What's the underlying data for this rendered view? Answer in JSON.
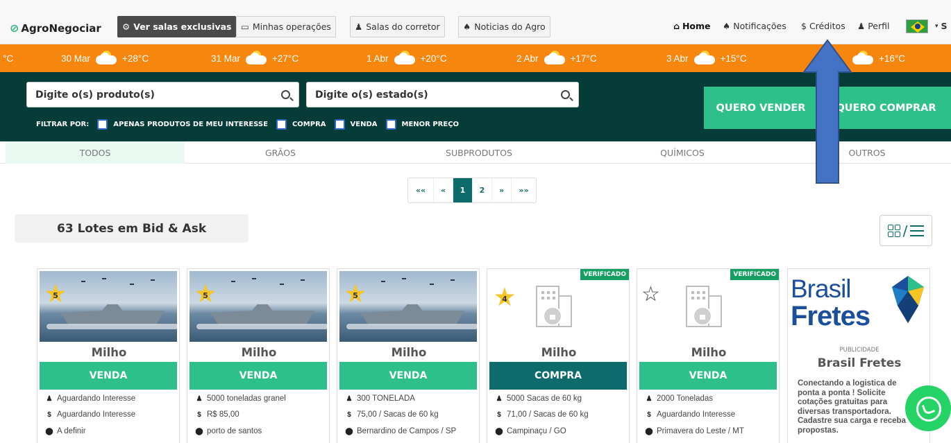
{
  "nav": {
    "logo": "AgroNegociar",
    "buttons": [
      {
        "label": "Ver salas exclusivas",
        "icon": "gear-icon"
      },
      {
        "label": "Minhas operações",
        "icon": "inbox-icon"
      },
      {
        "label": "Salas do corretor",
        "icon": "users-icon"
      },
      {
        "label": "Noticias do Agro",
        "icon": "bell-icon"
      }
    ],
    "right": [
      {
        "label": "Home",
        "icon": "home-icon"
      },
      {
        "label": "Notificações",
        "icon": "bell-icon"
      },
      {
        "label": "Créditos",
        "icon": "dollar-icon"
      },
      {
        "label": "Perfil",
        "icon": "user-icon"
      }
    ],
    "trailing": "S"
  },
  "weather": [
    {
      "date": "",
      "temp": "°C"
    },
    {
      "date": "30 Mar",
      "temp": "+28°C"
    },
    {
      "date": "31 Mar",
      "temp": "+27°C"
    },
    {
      "date": "1 Abr",
      "temp": "+20°C"
    },
    {
      "date": "2 Abr",
      "temp": "+17°C"
    },
    {
      "date": "3 Abr",
      "temp": "+15°C"
    },
    {
      "date": "",
      "temp": "+16°C"
    }
  ],
  "search": {
    "product_placeholder": "Digite o(s) produto(s)",
    "state_placeholder": "Digite o(s) estado(s)",
    "filter_label": "FILTRAR POR:",
    "filters": [
      "APENAS PRODUTOS DE MEU INTERESSE",
      "COMPRA",
      "VENDA",
      "MENOR PREÇO"
    ],
    "sell_button": "QUERO VENDER",
    "buy_button": "QUERO COMPRAR"
  },
  "tabs": [
    "TODOS",
    "GRÃOS",
    "SUBPRODUTOS",
    "QUÍMICOS",
    "OUTROS"
  ],
  "pager": [
    "««",
    "«",
    "1",
    "2",
    "»",
    "»»"
  ],
  "lots_title": "63 Lotes em Bid & Ask",
  "view_separator": "/",
  "cards": [
    {
      "rating": "5",
      "title": "Milho",
      "type": "VENDA",
      "qty": "Aguardando Interesse",
      "price": "Aguardando Interesse",
      "location": "A definir",
      "verified": ""
    },
    {
      "rating": "5",
      "title": "Milho",
      "type": "VENDA",
      "qty": "5000 toneladas granel",
      "price": "R$ 85,00",
      "location": "porto de santos",
      "verified": ""
    },
    {
      "rating": "5",
      "title": "Milho",
      "type": "VENDA",
      "qty": "300 TONELADA",
      "price": "75,00 / Sacas de 60 kg",
      "location": "Bernardino de Campos / SP",
      "verified": ""
    },
    {
      "rating": "4",
      "title": "Milho",
      "type": "COMPRA",
      "qty": "5000 Sacas de 60 kg",
      "price": "71,00 / Sacas de 60 kg",
      "location": "Campinaçu / GO",
      "verified": "VERIFICADO"
    },
    {
      "rating": "",
      "title": "Milho",
      "type": "VENDA",
      "qty": "2000 Toneladas",
      "price": "Aguardando Interesse",
      "location": "Primavera do Leste / MT",
      "verified": "VERIFICADO"
    }
  ],
  "ad": {
    "logo_line1": "Brasil",
    "logo_line2": "Fretes",
    "label": "PUBLICIDADE",
    "title": "Brasil Fretes",
    "description": "Conectando a logistica de ponta a ponta ! Solicite cotações gratuitas para diversas transportadora. Cadastre sua carga e receba propostas."
  },
  "colors": {
    "accent_green": "#2ec08b",
    "dark_teal": "#063c38",
    "weather_orange": "#f7860f",
    "arrow_blue": "#4472c4"
  }
}
